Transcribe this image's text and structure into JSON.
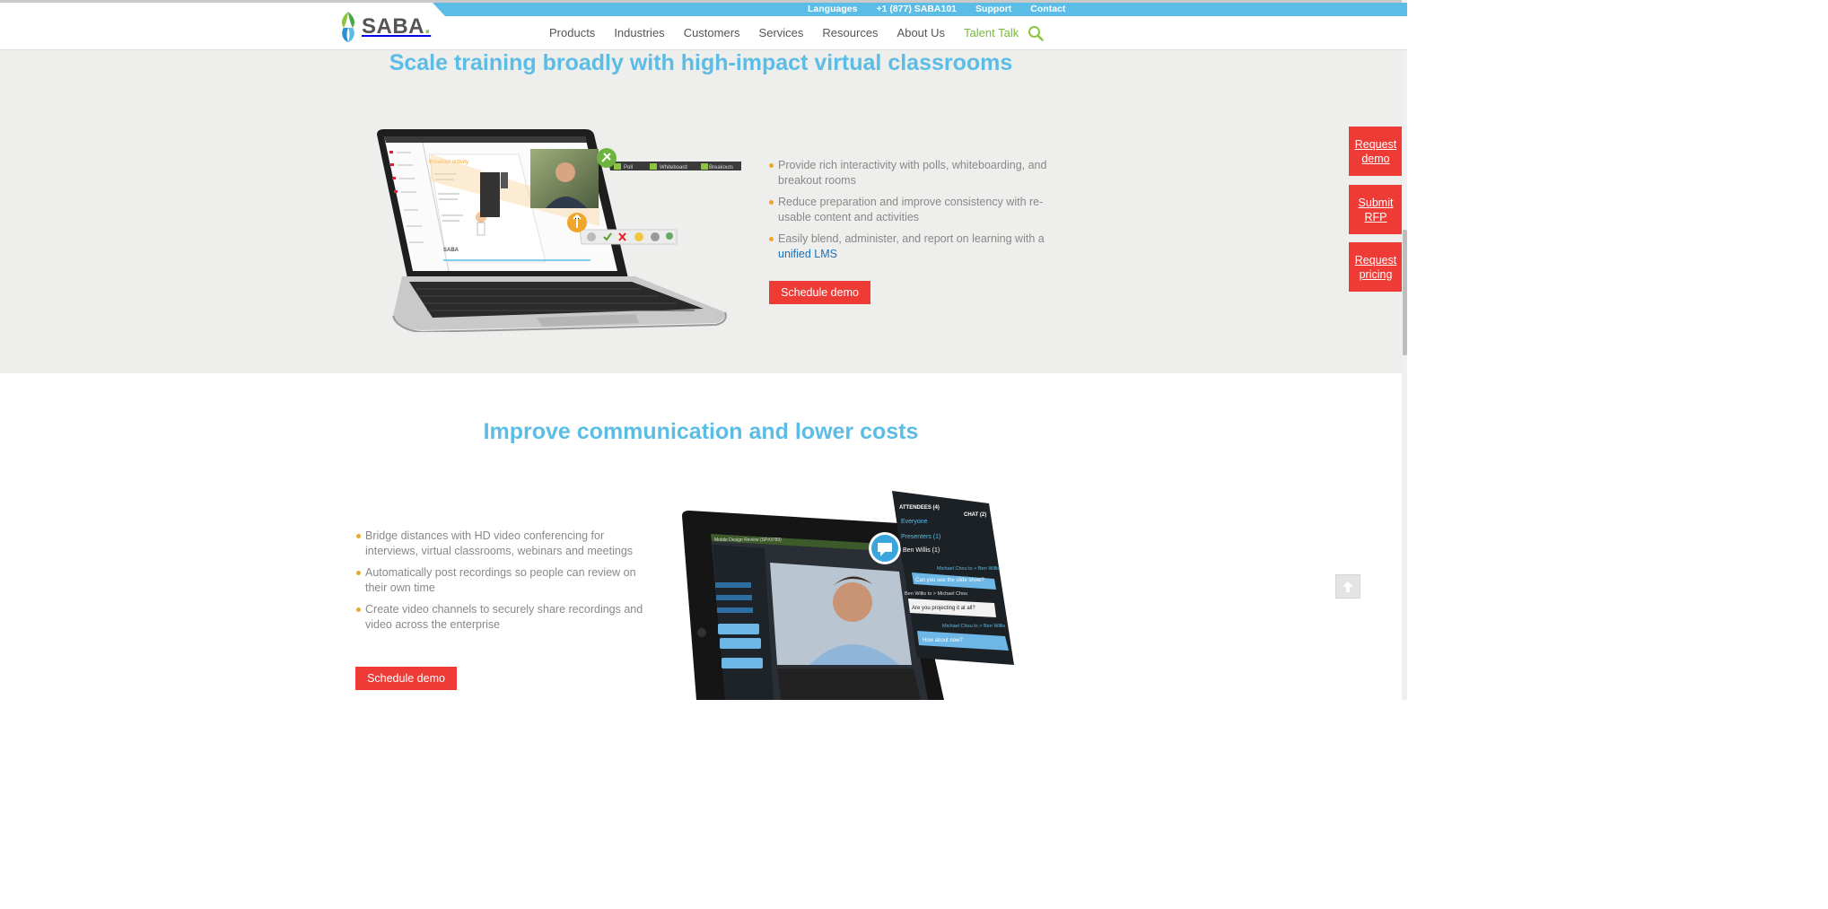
{
  "header": {
    "logo_text": "SABA",
    "utility_links": [
      "Languages",
      "+1 (877) SABA101",
      "Support",
      "Contact"
    ],
    "nav_items": [
      "Products",
      "Industries",
      "Customers",
      "Services",
      "Resources",
      "About Us"
    ],
    "talent_talk": "Talent Talk",
    "search_icon": "magnifier-icon"
  },
  "section1": {
    "title": "Scale training broadly with high-impact virtual classrooms",
    "bullets": [
      "Provide rich interactivity with polls, whiteboarding, and breakout rooms",
      "Reduce preparation and improve consistency with re-usable content and activities"
    ],
    "bullet3_text": "Easily blend, administer, and report on learning with a",
    "bullet3_link": "unified LMS",
    "button": "Schedule demo",
    "image": {
      "toolbar_labels": [
        "Poll",
        "Whiteboard",
        "Breakouts"
      ],
      "slide_heading": "Breakout activity",
      "slide_brand": "SABA"
    }
  },
  "section2": {
    "title": "Improve communication and lower costs",
    "bullets": [
      "Bridge distances with HD video conferencing for interviews, virtual classrooms, webinars and meetings",
      "Automatically post recordings so people can review on their own time",
      "Create video channels to securely share recordings and video across the enterprise"
    ],
    "button": "Schedule demo",
    "image": {
      "attendees": "ATTENDEES (4)",
      "chat": "CHAT (2)",
      "everyone": "Everyone",
      "presenters": "Presenters (1)",
      "ben": "Ben Willis (1)",
      "msg1_from": "Michael Chou to > Ben Willis",
      "msg1": "Can you see the slide show?",
      "msg2_from": "Ben Willis to > Michael Chou",
      "msg2": "Are you projecting it at all?",
      "msg3_from": "Michael Chou to > Ben Willis",
      "msg3": "How about now?",
      "session_title": "Mobile Design Review (SP#3789)"
    }
  },
  "side_buttons": [
    "Request demo",
    "Submit RFP",
    "Request pricing"
  ],
  "colors": {
    "brand_blue": "#5bbde6",
    "cta_red": "#ef3b36",
    "talent_green": "#7bb83a",
    "bullet_orange": "#f0a62a",
    "section_gray": "#eeeeec"
  }
}
